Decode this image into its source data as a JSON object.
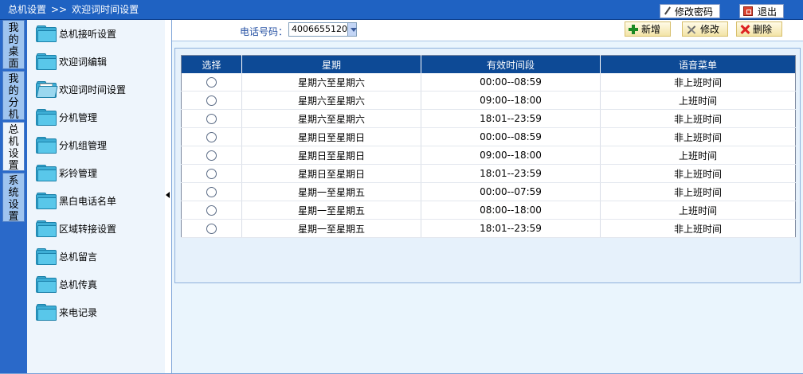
{
  "breadcrumb": {
    "parent": "总机设置",
    "separator": ">>",
    "current": "欢迎词时间设置"
  },
  "header": {
    "change_password": "修改密码",
    "exit": "退出"
  },
  "vtabs": [
    {
      "label": "我的桌面"
    },
    {
      "label": "我的分机"
    },
    {
      "label": "总机设置"
    },
    {
      "label": "系统设置"
    }
  ],
  "menu": [
    {
      "label": "总机接听设置"
    },
    {
      "label": "欢迎词编辑"
    },
    {
      "label": "欢迎词时间设置"
    },
    {
      "label": "分机管理"
    },
    {
      "label": "分机组管理"
    },
    {
      "label": "彩铃管理"
    },
    {
      "label": "黑白电话名单"
    },
    {
      "label": "区域转接设置"
    },
    {
      "label": "总机留言"
    },
    {
      "label": "总机传真"
    },
    {
      "label": "来电记录"
    }
  ],
  "toolbar": {
    "phone_label": "电话号码：",
    "phone_value": "4006655120",
    "add": "新增",
    "edit": "修改",
    "delete": "删除"
  },
  "table": {
    "headers": [
      "选择",
      "星期",
      "有效时间段",
      "语音菜单"
    ],
    "rows": [
      {
        "week": "星期六至星期六",
        "time": "00:00--08:59",
        "menu": "非上班时间"
      },
      {
        "week": "星期六至星期六",
        "time": "09:00--18:00",
        "menu": "上班时间"
      },
      {
        "week": "星期六至星期六",
        "time": "18:01--23:59",
        "menu": "非上班时间"
      },
      {
        "week": "星期日至星期日",
        "time": "00:00--08:59",
        "menu": "非上班时间"
      },
      {
        "week": "星期日至星期日",
        "time": "09:00--18:00",
        "menu": "上班时间"
      },
      {
        "week": "星期日至星期日",
        "time": "18:01--23:59",
        "menu": "非上班时间"
      },
      {
        "week": "星期一至星期五",
        "time": "00:00--07:59",
        "menu": "非上班时间"
      },
      {
        "week": "星期一至星期五",
        "time": "08:00--18:00",
        "menu": "上班时间"
      },
      {
        "week": "星期一至星期五",
        "time": "18:01--23:59",
        "menu": "非上班时间"
      }
    ]
  },
  "colors": {
    "header_blue": "#1f62c2",
    "table_header": "#0d4a96",
    "panel_bg": "#eaf5fd"
  }
}
